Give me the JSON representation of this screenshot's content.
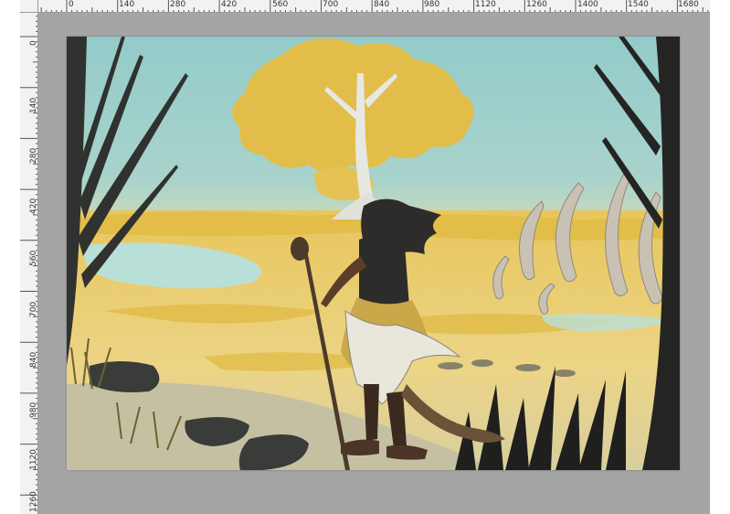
{
  "colors": {
    "workspace": "#a5a5a5",
    "ruler_bg": "#f2f2f2",
    "sky": "#9fcfcc",
    "sky_horizon": "#c9dcc0",
    "meadow": "#e6c45a",
    "water": "#b8ddd2",
    "tree_foliage": "#e2bd4a",
    "trunk": "#dfe3dc",
    "silhouette": "#2a2c2a",
    "path": "#c9c3a4"
  },
  "rulers": {
    "horizontal_labels": [
      "0",
      "140",
      "280",
      "420",
      "560",
      "700",
      "840",
      "980",
      "1120",
      "1260",
      "1400",
      "1540",
      "1680"
    ],
    "vertical_labels": [
      "0",
      "140",
      "280",
      "420",
      "560",
      "700",
      "840",
      "980",
      "1120",
      "1260"
    ]
  },
  "canvas": {
    "content": "Digital painting: a figure with a staff looking toward a golden tree across a yellow meadow, with large curved tusks on the right and dark silhouetted trees framing the scene"
  }
}
